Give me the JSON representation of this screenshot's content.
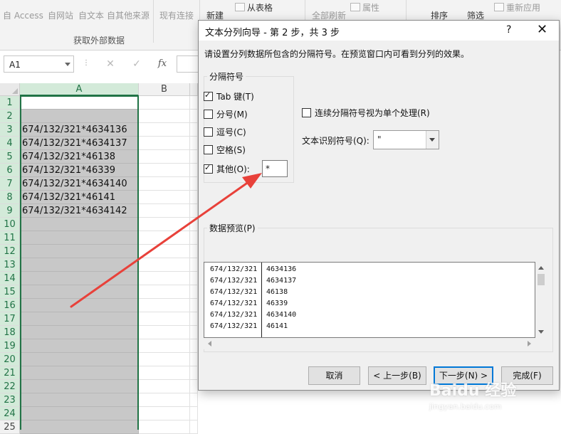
{
  "ribbon": {
    "items": [
      "自 Access",
      "自网站",
      "自文本",
      "自其他来源",
      "现有连接",
      "新建",
      "从表格",
      "全部刷新",
      "属性",
      "排序",
      "筛选",
      "重新应用"
    ],
    "group_label": "获取外部数据"
  },
  "formula_bar": {
    "name_box": "A1",
    "fx": "fx"
  },
  "grid": {
    "columns": [
      "A",
      "B"
    ],
    "rows": [
      "1",
      "2",
      "3",
      "4",
      "5",
      "6",
      "7",
      "8",
      "9",
      "10",
      "11",
      "12",
      "13",
      "14",
      "15",
      "16",
      "17",
      "18",
      "19",
      "20",
      "21",
      "22",
      "23",
      "24",
      "25"
    ],
    "cells_a": [
      "",
      "",
      "674/132/321*4634136",
      "674/132/321*4634137",
      "674/132/321*46138",
      "674/132/321*46339",
      "674/132/321*4634140",
      "674/132/321*46141",
      "674/132/321*4634142"
    ]
  },
  "dialog": {
    "title": "文本分列向导 - 第 2 步，共 3 步",
    "help": "?",
    "close": "✕",
    "description": "请设置分列数据所包含的分隔符号。在预览窗口内可看到分列的效果。",
    "delimiters_label": "分隔符号",
    "delimiters": [
      {
        "label": "Tab 键(T)",
        "checked": true
      },
      {
        "label": "分号(M)",
        "checked": false
      },
      {
        "label": "逗号(C)",
        "checked": false
      },
      {
        "label": "空格(S)",
        "checked": false
      },
      {
        "label": "其他(O):",
        "checked": true
      }
    ],
    "other_value": "*",
    "consecutive_label": "连续分隔符号视为单个处理(R)",
    "qualifier_label": "文本识别符号(Q):",
    "qualifier_value": "\"",
    "preview_label": "数据预览(P)",
    "preview_rows": [
      [
        "674/132/321",
        "4634136"
      ],
      [
        "674/132/321",
        "4634137"
      ],
      [
        "674/132/321",
        "46138"
      ],
      [
        "674/132/321",
        "46339"
      ],
      [
        "674/132/321",
        "4634140"
      ],
      [
        "674/132/321",
        "46141"
      ]
    ],
    "buttons": {
      "cancel": "取消",
      "back": "< 上一步(B)",
      "next": "下一步(N) >",
      "finish": "完成(F)"
    }
  },
  "watermark": {
    "main": "Baidu 经验",
    "sub": "jingyan.baidu.com"
  },
  "colors": {
    "accent_green": "#217346",
    "arrow_red": "#e8413a",
    "focus_blue": "#0078d7"
  }
}
